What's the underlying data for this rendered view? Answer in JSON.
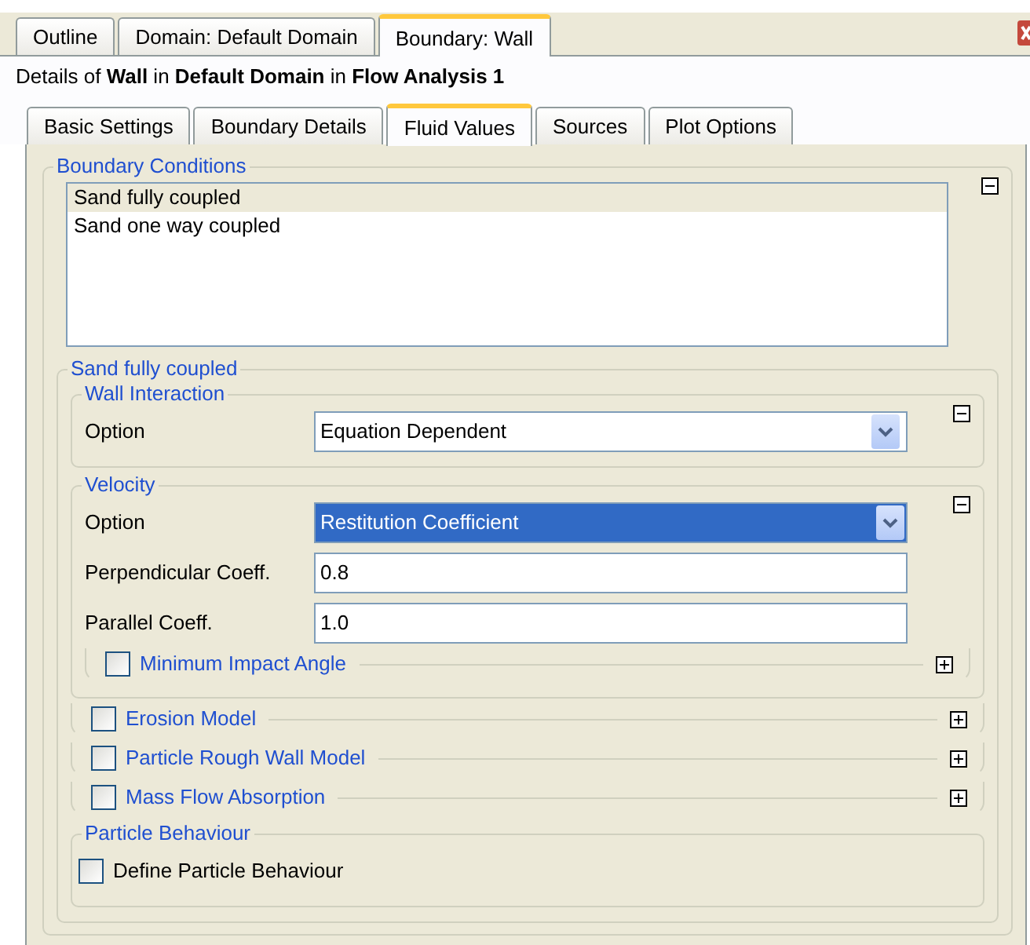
{
  "top_tabs": [
    {
      "label": "Outline",
      "selected": false
    },
    {
      "label": "Domain: Default Domain",
      "selected": false
    },
    {
      "label": "Boundary: Wall",
      "selected": true
    }
  ],
  "details": "Details of **Wall** in **Default Domain** in **Flow Analysis 1**",
  "sub_tabs": [
    {
      "label": "Basic Settings",
      "selected": false
    },
    {
      "label": "Boundary Details",
      "selected": false
    },
    {
      "label": "Fluid Values",
      "selected": true
    },
    {
      "label": "Sources",
      "selected": false
    },
    {
      "label": "Plot Options",
      "selected": false
    }
  ],
  "boundary_conditions": {
    "title": "Boundary Conditions",
    "expanded": true,
    "items": [
      {
        "label": "Sand fully coupled",
        "selected": true
      },
      {
        "label": "Sand one way coupled",
        "selected": false
      }
    ]
  },
  "section": {
    "title": "Sand fully coupled",
    "children": [
      {
        "kind": "group",
        "title": "Wall Interaction",
        "expanded": true,
        "children": [
          {
            "kind": "select",
            "label": "Option",
            "value": "Equation Dependent",
            "highlighted": false
          }
        ]
      },
      {
        "kind": "group",
        "title": "Velocity",
        "expanded": true,
        "children": [
          {
            "kind": "select",
            "label": "Option",
            "value": "Restitution Coefficient",
            "highlighted": true
          },
          {
            "kind": "text",
            "label": "Perpendicular Coeff.",
            "value": "0.8"
          },
          {
            "kind": "text",
            "label": "Parallel Coeff.",
            "value": "1.0"
          },
          {
            "kind": "option",
            "title": "Minimum Impact Angle",
            "checked": false,
            "expanded": false
          }
        ]
      },
      {
        "kind": "option",
        "title": "Erosion Model",
        "checked": false,
        "expanded": false
      },
      {
        "kind": "option",
        "title": "Particle Rough Wall Model",
        "checked": false,
        "expanded": false
      },
      {
        "kind": "option",
        "title": "Mass Flow Absorption",
        "checked": false,
        "expanded": false
      },
      {
        "kind": "group",
        "title": "Particle Behaviour",
        "children": [
          {
            "kind": "checkbox",
            "label": "Define Particle Behaviour",
            "checked": false
          }
        ]
      }
    ]
  }
}
